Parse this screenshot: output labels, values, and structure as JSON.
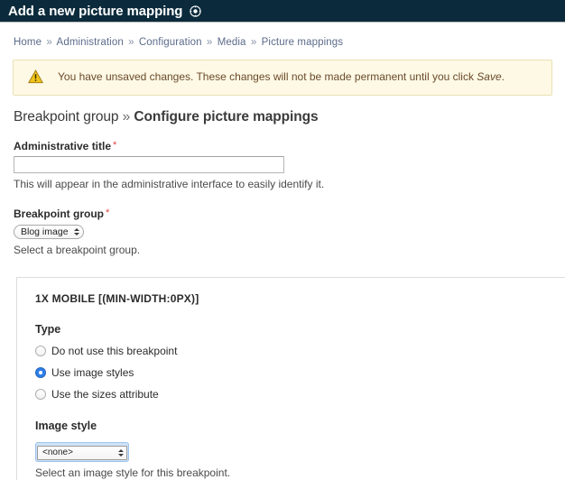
{
  "titlebar": {
    "title": "Add a new picture mapping",
    "icon": "target-circle-icon"
  },
  "breadcrumb": {
    "separator": "»",
    "items": [
      {
        "label": "Home"
      },
      {
        "label": "Administration"
      },
      {
        "label": "Configuration"
      },
      {
        "label": "Media"
      },
      {
        "label": "Picture mappings"
      }
    ]
  },
  "message": {
    "icon": "warning-triangle-icon",
    "text_before": "You have unsaved changes. These changes will not be made permanent until you click ",
    "emphasis": "Save",
    "text_after": "."
  },
  "section": {
    "prefix": "Breakpoint group",
    "separator": "»",
    "title": "Configure picture mappings"
  },
  "admin_title_field": {
    "label": "Administrative title",
    "required_marker": "*",
    "value": "",
    "placeholder": "",
    "description": "This will appear in the administrative interface to easily identify it."
  },
  "breakpoint_group_field": {
    "label": "Breakpoint group",
    "required_marker": "*",
    "selected": "Blog image",
    "description": "Select a breakpoint group."
  },
  "fieldset": {
    "legend": "1X MOBILE [(MIN-WIDTH:0PX)]",
    "type_label": "Type",
    "radios": [
      {
        "label": "Do not use this breakpoint",
        "checked": false
      },
      {
        "label": "Use image styles",
        "checked": true
      },
      {
        "label": "Use the sizes attribute",
        "checked": false
      }
    ],
    "image_style": {
      "label": "Image style",
      "selected": "<none>",
      "description": "Select an image style for this breakpoint."
    }
  },
  "colors": {
    "titlebar_bg": "#0b2b3c",
    "accent_blue": "#2f7fe8",
    "warning_bg": "#fdf9e5",
    "warning_border": "#e9e1b4",
    "required_red": "#e04141",
    "link_blue": "#5c6b8a",
    "focus_halo": "#cfe2f7"
  }
}
